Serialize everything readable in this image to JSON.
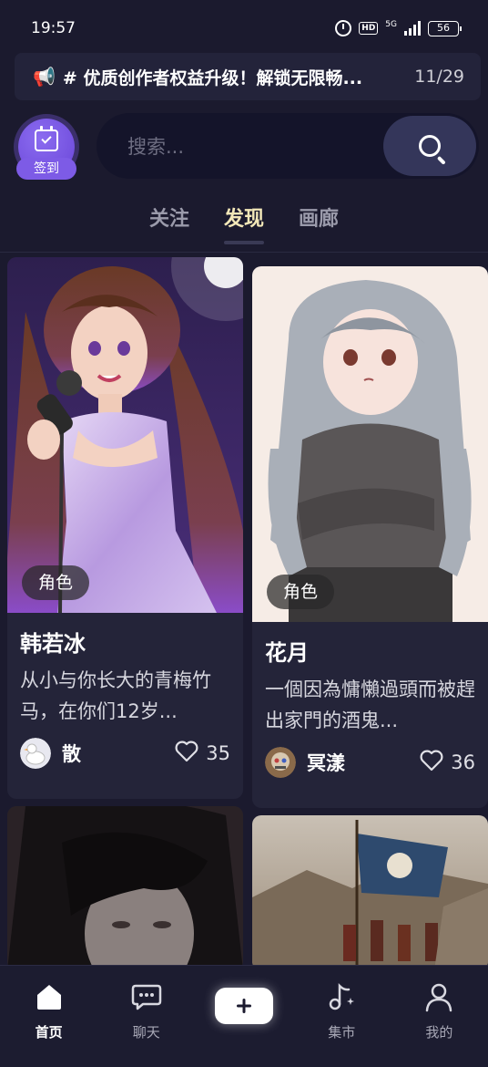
{
  "status_bar": {
    "time": "19:57",
    "hd": "HD",
    "network": "5G",
    "battery": "56"
  },
  "announcement": {
    "icon": "megaphone-icon",
    "text": "# 优质创作者权益升级！解锁无限畅...",
    "counter": "11/29"
  },
  "checkin": {
    "label": "签到",
    "icon": "calendar-check-icon",
    "color": "#7d5be6"
  },
  "search": {
    "placeholder": "搜索..."
  },
  "tabs": [
    {
      "label": "关注",
      "active": false
    },
    {
      "label": "发现",
      "active": true
    },
    {
      "label": "画廊",
      "active": false
    }
  ],
  "cards": [
    {
      "tag": "角色",
      "title": "韩若冰",
      "description": "从小与你长大的青梅竹马，在你们12岁...",
      "author": "散",
      "likes": "35"
    },
    {
      "tag": "角色",
      "title": "花月",
      "description": "一個因為慵懶過頭而被趕出家門的酒鬼...",
      "author": "冥漾",
      "likes": "36"
    }
  ],
  "bottom_nav": [
    {
      "label": "首页",
      "icon": "home-icon",
      "active": true
    },
    {
      "label": "聊天",
      "icon": "chat-icon",
      "active": false
    },
    {
      "label": "",
      "icon": "add-icon",
      "active": false
    },
    {
      "label": "集市",
      "icon": "music-note-icon",
      "active": false
    },
    {
      "label": "我的",
      "icon": "profile-icon",
      "active": false
    }
  ],
  "colors": {
    "background": "#1b1a2e",
    "active_tab": "#f2e7b8",
    "card": "#242439"
  }
}
